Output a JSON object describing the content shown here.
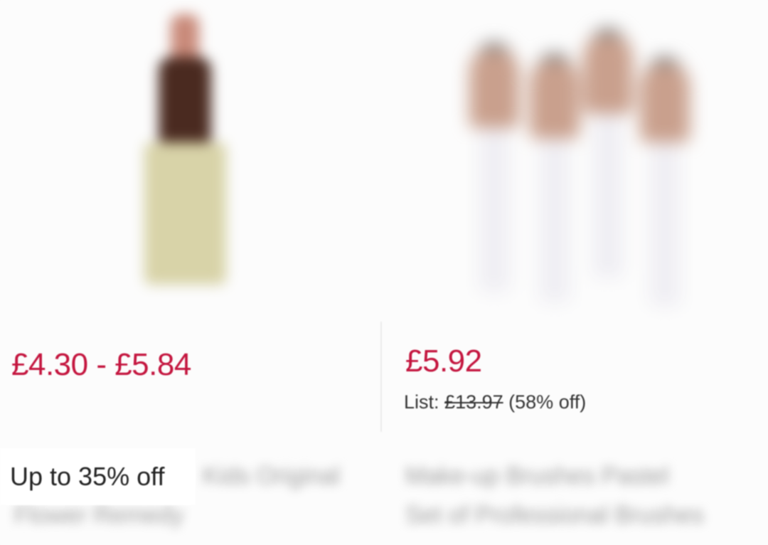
{
  "products": [
    {
      "price": "£4.30 - £5.84",
      "badge": "Up to 35% off",
      "image_icon": "bottle-product-image",
      "title_lines": [
        "Kids Original",
        "Flower Remedy"
      ]
    },
    {
      "price": "£5.92",
      "list_label": "List:",
      "list_price": "£13.97",
      "discount": "(58% off)",
      "image_icon": "makeup-brushes-product-image",
      "title_lines": [
        "Make-up Brushes Pastel",
        "Set of Professional Brushes"
      ]
    }
  ],
  "colors": {
    "price": "#c4163f",
    "background": "#fcfcfc"
  }
}
